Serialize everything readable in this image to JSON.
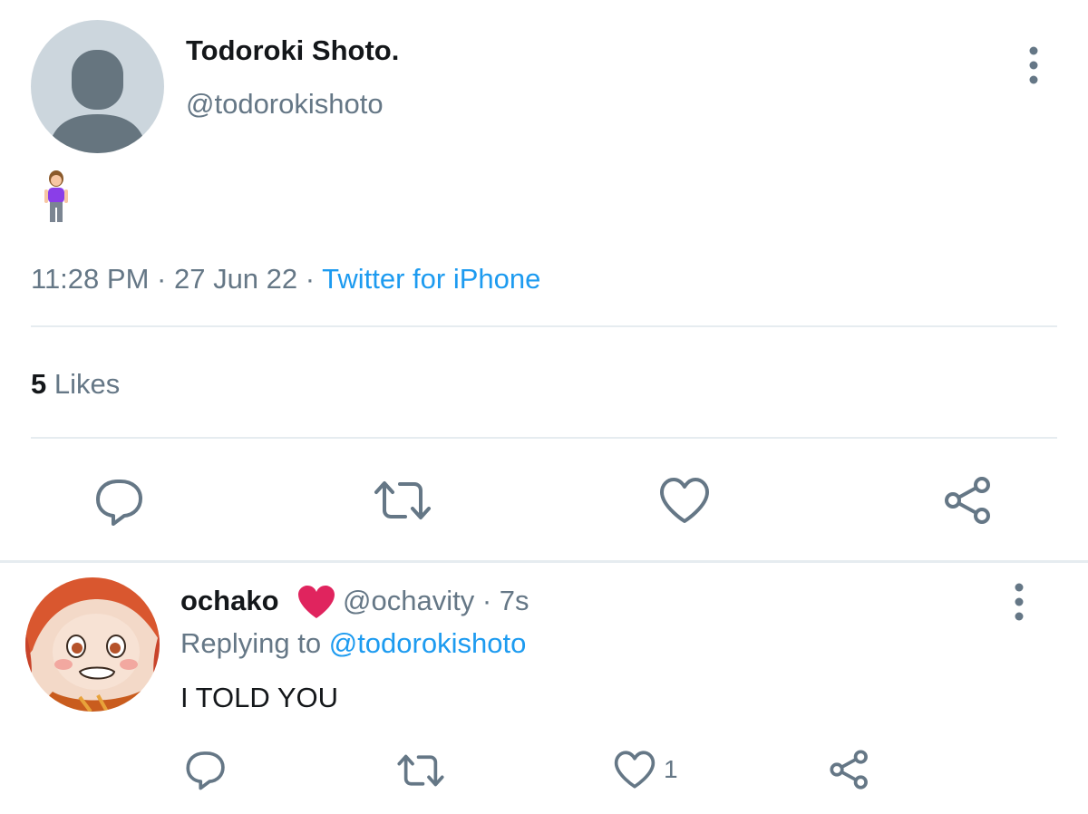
{
  "tweet": {
    "author": {
      "name": "Todoroki Shoto.",
      "handle": "@todorokishoto"
    },
    "content_emoji": "woman-standing-purple-shirt",
    "time": "11:28 PM",
    "separator": "·",
    "date": "27 Jun 22",
    "source": "Twitter for iPhone",
    "likes_count": "5",
    "likes_label": "Likes",
    "actions": [
      "reply-icon",
      "retweet-icon",
      "like-icon",
      "share-icon"
    ]
  },
  "reply": {
    "author": {
      "name": "ochako",
      "emoji": "red-heart",
      "handle": "@ochavity",
      "time_ago": "7s"
    },
    "meta_sep": "·",
    "replying_label": "Replying to",
    "replying_to": "@todorokishoto",
    "text": "I TOLD YOU",
    "like_count": "1",
    "actions": [
      "reply-icon",
      "retweet-icon",
      "like-icon",
      "share-icon"
    ]
  },
  "colors": {
    "primary_text": "#14171a",
    "secondary_text": "#657786",
    "link": "#1d9bf0",
    "divider": "#e6ecf0",
    "heart": "#e0245e"
  }
}
